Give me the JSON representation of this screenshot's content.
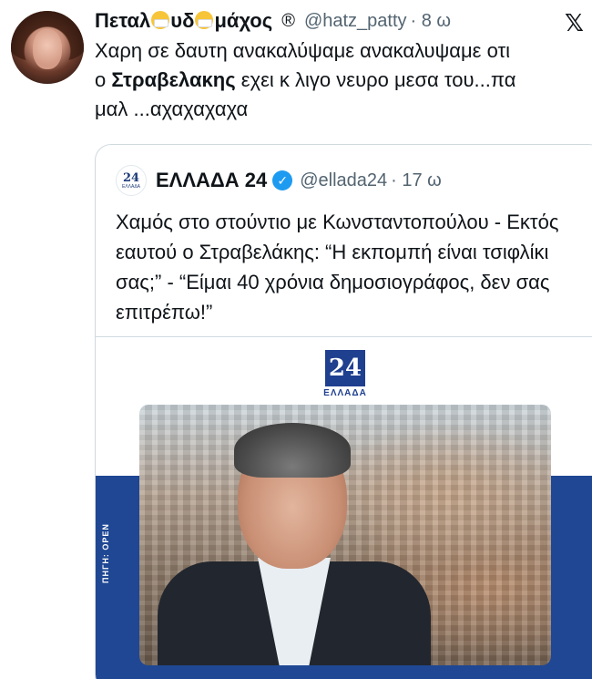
{
  "tweet": {
    "display_name_parts": [
      "Πεταλ",
      "υδ",
      "μάχος"
    ],
    "registered_mark": "®",
    "handle": "@hatz_patty",
    "time": "· 8 ω",
    "x_logo": "𝕏",
    "text_line1": "Χαρη σε δαυτη ανακαλύψαμε ανακαλυψαμε οτι",
    "text_line2_prefix": "ο ",
    "text_line2_bold": "Στραβελακης",
    "text_line2_suffix": " εχει κ λιγο νευρο μεσα του...πα",
    "text_line3": "μαλ ...αχαχαχαχα"
  },
  "quoted": {
    "avatar_number": "24",
    "avatar_small": "ΕΛΛΑΔΑ",
    "name": "ΕΛΛΑΔΑ 24",
    "verified_icon": "✓",
    "handle": "@ellada24",
    "time": "· 17 ω",
    "text": "Χαμός στο στούντιο με Κωνσταντοπούλου - Εκτός εαυτού ο Στραβελάκης: “Η εκπομπή είναι τσιφλίκι σας;” - “Είμαι 40 χρόνια δημοσιογράφος, δεν σας επιτρέπω!”",
    "media": {
      "logo_number": "24",
      "logo_text": "ΕΛΛΑΔΑ",
      "source_label": "ΠΗΓΗ: OPEN"
    }
  },
  "colors": {
    "brand_blue": "#1f4793",
    "verified_blue": "#1d9bf0",
    "secondary_text": "#536471"
  }
}
